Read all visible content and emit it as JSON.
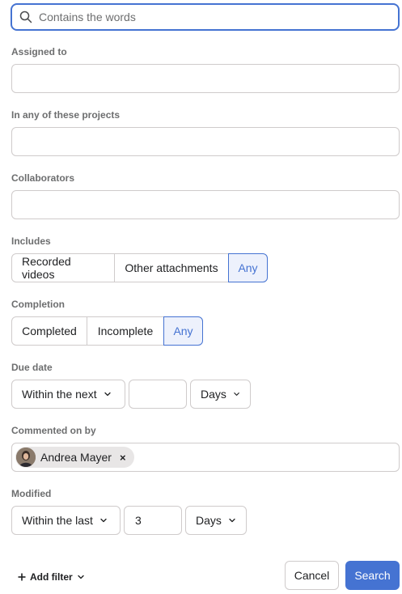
{
  "search": {
    "placeholder": "Contains the words",
    "value": ""
  },
  "assigned_to": {
    "label": "Assigned to",
    "value": ""
  },
  "projects": {
    "label": "In any of these projects",
    "value": ""
  },
  "collaborators": {
    "label": "Collaborators",
    "value": ""
  },
  "includes": {
    "label": "Includes",
    "options": [
      "Recorded videos",
      "Other attachments",
      "Any"
    ],
    "selected": "Any"
  },
  "completion": {
    "label": "Completion",
    "options": [
      "Completed",
      "Incomplete",
      "Any"
    ],
    "selected": "Any"
  },
  "due_date": {
    "label": "Due date",
    "range": "Within the next",
    "value": "",
    "unit": "Days"
  },
  "commented_on_by": {
    "label": "Commented on by",
    "tokens": [
      {
        "name": "Andrea Mayer",
        "remove": "×"
      }
    ]
  },
  "modified": {
    "label": "Modified",
    "range": "Within the last",
    "value": "3",
    "unit": "Days"
  },
  "footer": {
    "add_filter": "Add filter",
    "cancel": "Cancel",
    "search": "Search"
  },
  "colors": {
    "accent": "#4573d2",
    "selected_bg": "#edf1fc",
    "border": "#cfcbcb",
    "label": "#6d6e6f"
  },
  "icons": {
    "search": "search-icon",
    "chevron": "chevron-down-icon",
    "plus": "plus-icon",
    "close": "close-icon"
  }
}
